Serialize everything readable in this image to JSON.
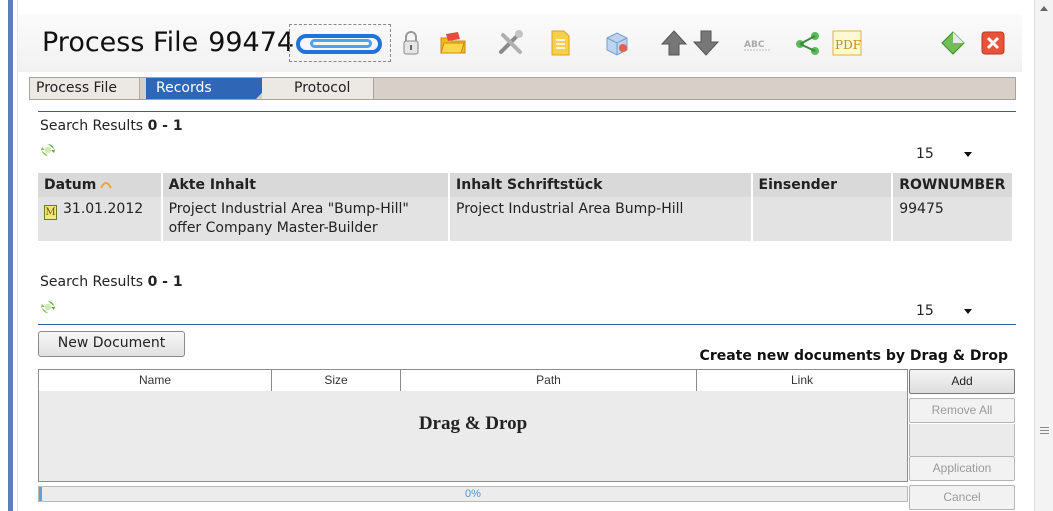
{
  "header": {
    "title": "Process File",
    "file_number": "99474",
    "toolbar_icons": [
      "paperclip-icon",
      "lock-icon",
      "folder-icon",
      "tools-icon",
      "document-icon",
      "box-icon",
      "arrow-up-icon",
      "arrow-down-icon",
      "spellcheck-icon",
      "share-icon",
      "pdf-icon",
      "diamond-icon",
      "close-icon"
    ],
    "pdf_label": "PDF",
    "close_color": "#e8533a"
  },
  "tabs": [
    {
      "label": "Process File",
      "active": false
    },
    {
      "label": "Records",
      "active": true
    },
    {
      "label": "Protocol",
      "active": false
    }
  ],
  "results_top": {
    "label": "Search Results",
    "range": "0 - 1",
    "page_size": "15"
  },
  "table": {
    "columns": [
      "Datum",
      "Akte Inhalt",
      "Inhalt Schriftstück",
      "Einsender",
      "ROWNUMBER"
    ],
    "rows": [
      {
        "icon_letter": "M",
        "datum": "31.01.2012",
        "akte_line1": "Project Industrial Area \"Bump-Hill\"",
        "akte_line2": "offer Company Master-Builder",
        "inhalt": "Project Industrial Area Bump-Hill",
        "einsender": "",
        "rownumber": "99475"
      }
    ]
  },
  "results_bottom": {
    "label": "Search Results",
    "range": "0 - 1",
    "page_size": "15"
  },
  "upload": {
    "new_document_label": "New Document",
    "hint": "Create new documents by Drag & Drop",
    "columns": [
      "Name",
      "Size",
      "Path",
      "Link"
    ],
    "drop_text": "Drag & Drop",
    "buttons": {
      "add": "Add",
      "remove_all": "Remove All",
      "application": "Application",
      "cancel": "Cancel"
    },
    "progress_fraction": 0,
    "progress_label": "0%"
  },
  "colors": {
    "accent": "#2f67b6",
    "tab_bar": "#d8d0c8",
    "row_bg": "#e3e3e3",
    "header_bg": "#d9d9d9"
  }
}
